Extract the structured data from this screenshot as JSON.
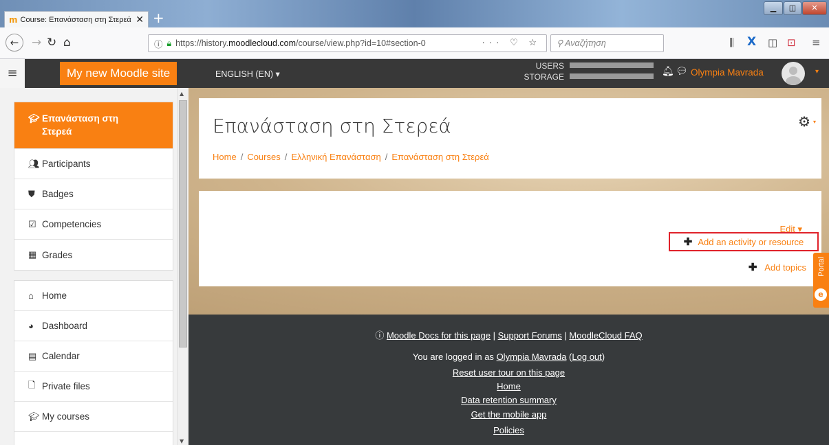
{
  "browser": {
    "tab_title": "Course: Επανάσταση στη Στερεά",
    "url_prefix": "https://history.",
    "url_host": "moodlecloud.com",
    "url_path": "/course/view.php?id=10#section-0",
    "search_placeholder": "Αναζήτηση"
  },
  "header": {
    "site_name": "My new Moodle site",
    "language": "ENGLISH (EN)",
    "users_label": "USERS",
    "storage_label": "STORAGE",
    "user_name": "Olympia Mavrada"
  },
  "drawer": {
    "course_items": [
      {
        "label": "Επανάσταση στη Στερεά",
        "icon": "graduation-cap-icon"
      },
      {
        "label": "Participants",
        "icon": "users-icon"
      },
      {
        "label": "Badges",
        "icon": "shield-icon"
      },
      {
        "label": "Competencies",
        "icon": "check-square-icon"
      },
      {
        "label": "Grades",
        "icon": "table-icon"
      }
    ],
    "site_items": [
      {
        "label": "Home",
        "icon": "home-icon"
      },
      {
        "label": "Dashboard",
        "icon": "dashboard-icon"
      },
      {
        "label": "Calendar",
        "icon": "calendar-icon"
      },
      {
        "label": "Private files",
        "icon": "file-icon"
      },
      {
        "label": "My courses",
        "icon": "graduation-cap-icon"
      }
    ]
  },
  "main": {
    "page_title": "Επανάσταση στη Στερεά",
    "breadcrumb": [
      "Home",
      "Courses",
      "Ελληνική Επανάσταση",
      "Επανάσταση στη Στερεά"
    ],
    "edit_label": "Edit",
    "add_activity_label": "Add an activity or resource",
    "add_topics_label": "Add topics",
    "portal_label": "Portal"
  },
  "footer": {
    "docs_link": "Moodle Docs for this page",
    "forums_link": "Support Forums",
    "faq_link": "MoodleCloud FAQ",
    "logged_in_prefix": "You are logged in as",
    "logged_in_user": "Olympia Mavrada",
    "logout_link": "Log out",
    "reset_tour": "Reset user tour on this page",
    "home": "Home",
    "data_retention": "Data retention summary",
    "mobile_app": "Get the mobile app",
    "policies": "Policies"
  },
  "colors": {
    "accent": "#f98012",
    "header_bg": "#383838",
    "footer_bg": "#373a3c",
    "highlight_border": "#e0222a"
  }
}
